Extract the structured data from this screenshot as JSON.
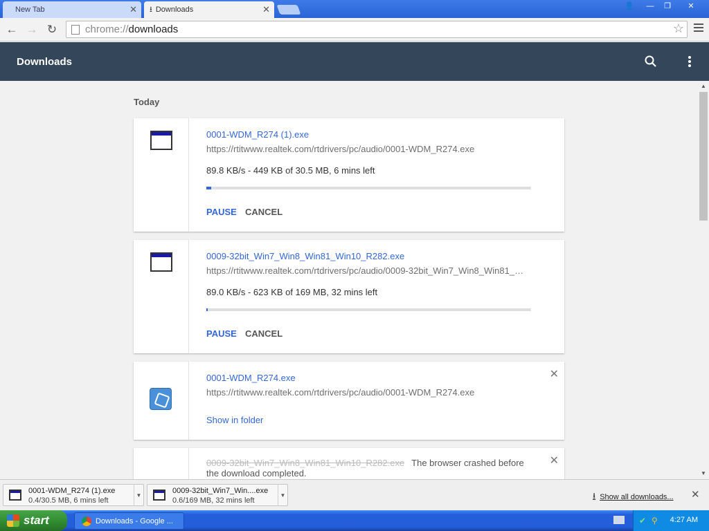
{
  "browser": {
    "tabs": [
      {
        "label": "New Tab",
        "active": false
      },
      {
        "label": "Downloads",
        "active": true
      }
    ],
    "address": {
      "scheme": "chrome://",
      "path": "downloads"
    }
  },
  "app": {
    "title": "Downloads"
  },
  "section": {
    "label": "Today"
  },
  "downloads": [
    {
      "filename": "0001-WDM_R274 (1).exe",
      "url": "https://rtitwww.realtek.com/rtdrivers/pc/audio/0001-WDM_R274.exe",
      "status": "89.8 KB/s - 449 KB of 30.5 MB, 6 mins left",
      "progress_percent": 1.5,
      "pause_label": "PAUSE",
      "cancel_label": "CANCEL"
    },
    {
      "filename": "0009-32bit_Win7_Win8_Win81_Win10_R282.exe",
      "url": "https://rtitwww.realtek.com/rtdrivers/pc/audio/0009-32bit_Win7_Win8_Win81_Wi...",
      "status": "89.0 KB/s - 623 KB of 169 MB, 32 mins left",
      "progress_percent": 0.4,
      "pause_label": "PAUSE",
      "cancel_label": "CANCEL"
    },
    {
      "filename": "0001-WDM_R274.exe",
      "url": "https://rtitwww.realtek.com/rtdrivers/pc/audio/0001-WDM_R274.exe",
      "link_label": "Show in folder"
    },
    {
      "filename": "0009-32bit_Win7_Win8_Win81_Win10_R282.exe",
      "message": "The browser crashed before the download completed."
    }
  ],
  "shelf": {
    "items": [
      {
        "name": "0001-WDM_R274 (1).exe",
        "status": "0.4/30.5 MB, 6 mins left"
      },
      {
        "name": "0009-32bit_Win7_Win....exe",
        "status": "0.6/169 MB, 32 mins left"
      }
    ],
    "show_all_label": "Show all downloads..."
  },
  "taskbar": {
    "start_label": "start",
    "task_label": "Downloads - Google ...",
    "clock": "4:27 AM"
  },
  "colors": {
    "header": "#344659",
    "link": "#3367d6",
    "taskbar": "#245edb",
    "start": "#2f8a2f"
  }
}
